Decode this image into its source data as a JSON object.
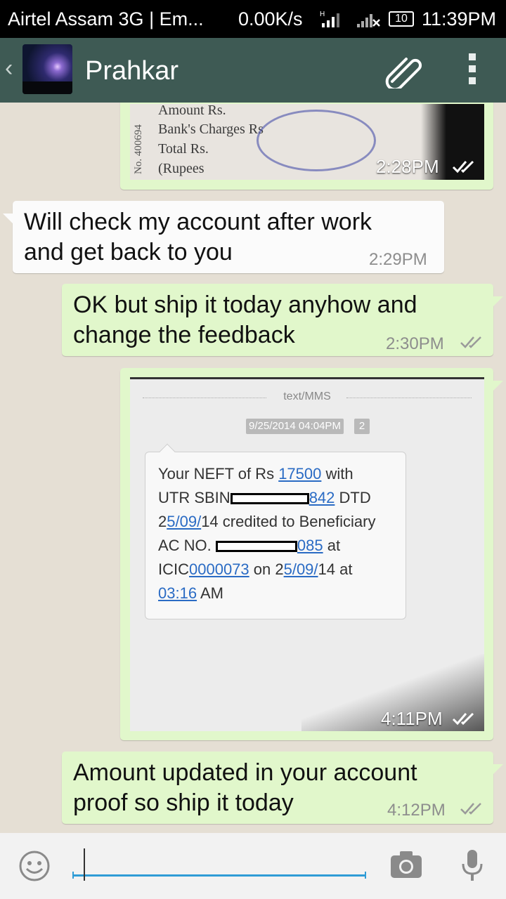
{
  "status_bar": {
    "carrier": "Airtel Assam 3G | Em...",
    "net_speed": "0.00K/s",
    "battery": "10",
    "time": "11:39PM"
  },
  "header": {
    "contact_name": "Prahkar",
    "icons": [
      "back-chevron-icon",
      "avatar",
      "paperclip-icon",
      "overflow-menu-icon"
    ]
  },
  "messages": [
    {
      "type": "image",
      "direction": "outgoing",
      "image_text": [
        "Amount Rs.",
        "Bank's Charges Rs",
        "Total Rs.",
        "(Rupees",
        "No. 400694"
      ],
      "time": "2:28PM",
      "status": "read"
    },
    {
      "type": "text",
      "direction": "incoming",
      "lines": [
        "Will check my account after work",
        "and get back to you"
      ],
      "time": "2:29PM"
    },
    {
      "type": "text",
      "direction": "outgoing",
      "lines": [
        "OK but ship it today anyhow and",
        "change the feedback"
      ],
      "time": "2:30PM",
      "status": "read"
    },
    {
      "type": "image",
      "direction": "outgoing",
      "screenshot": {
        "header": "text/MMS",
        "date": "9/25/2014 04:04PM",
        "count": "2",
        "sms": {
          "l1_a": "Your NEFT of Rs ",
          "l1_link": "17500",
          "l1_b": " with",
          "l2_a": "UTR SBIN",
          "l2_link": "842",
          "l2_b": " DTD",
          "l3_a": "2",
          "l3_link": "5/09/",
          "l3_b": "14 credited to Beneficiary",
          "l4_a": "AC NO. ",
          "l4_link": "085",
          "l4_b": " at",
          "l5_a": "ICIC",
          "l5_link1": "0000073",
          "l5_b": " on 2",
          "l5_link2": "5/09/",
          "l5_c": "14 at",
          "l6_link": "03:16",
          "l6_b": " AM"
        }
      },
      "time": "4:11PM",
      "status": "read"
    },
    {
      "type": "text",
      "direction": "outgoing",
      "lines": [
        "Amount updated in your account",
        "proof so ship it today"
      ],
      "time": "4:12PM",
      "status": "read"
    }
  ],
  "composer": {
    "value": "",
    "icons": [
      "emoji-icon",
      "camera-icon",
      "microphone-icon"
    ]
  }
}
